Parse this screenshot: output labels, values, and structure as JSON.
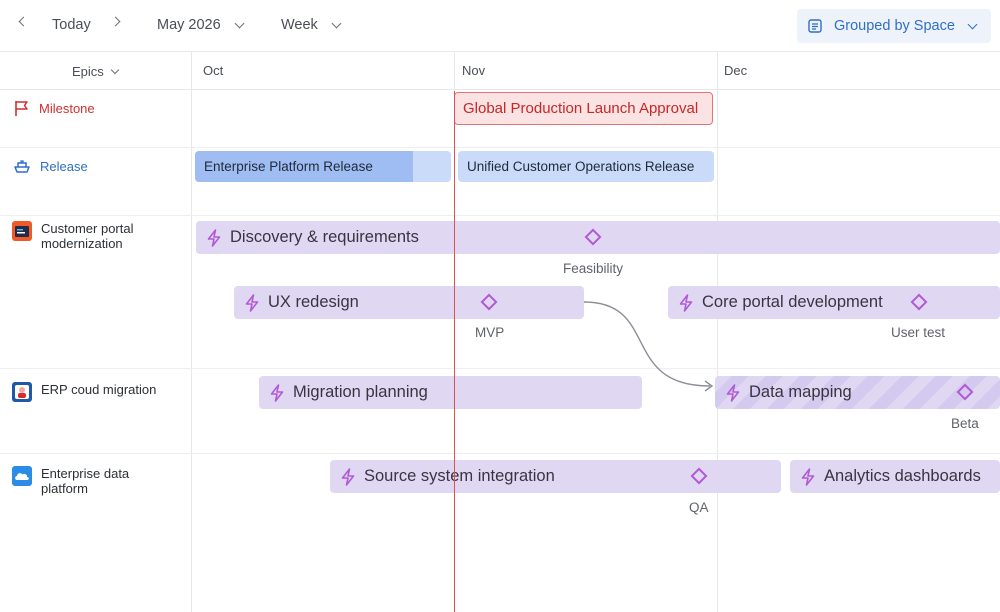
{
  "toolbar": {
    "today_label": "Today",
    "period_label": "May 2026",
    "scale_label": "Week",
    "grouping_label": "Grouped by Space"
  },
  "header": {
    "column_label": "Epics",
    "months": [
      "Oct",
      "Nov",
      "Dec"
    ]
  },
  "rows": {
    "milestone": {
      "label": "Milestone",
      "color": "#d32f2f"
    },
    "release": {
      "label": "Release",
      "color": "#2f6fc7"
    },
    "spaces": [
      {
        "label": "Customer portal modernization",
        "icon": "portal-app-icon"
      },
      {
        "label": "ERP coud migration",
        "icon": "erp-app-icon"
      },
      {
        "label": "Enterprise data platform",
        "icon": "cloud-app-icon"
      }
    ]
  },
  "bars": {
    "milestone": "Global Production Launch Approval",
    "releases": [
      {
        "label": "Enterprise Platform Release",
        "progress": 0.85
      },
      {
        "label": "Unified Customer Operations Release"
      }
    ],
    "epics": {
      "discovery": "Discovery & requirements",
      "ux": "UX redesign",
      "core": "Core portal development",
      "migration": "Migration planning",
      "mapping": "Data mapping",
      "source": "Source system integration",
      "analytics": "Analytics dashboards"
    },
    "milestones": {
      "feasibility": "Feasibility",
      "mvp": "MVP",
      "user_test": "User test",
      "beta": "Beta",
      "qa": "QA"
    }
  },
  "colors": {
    "accent": "#2f6fc7",
    "milestone": "#d32f2f",
    "epic_fill": "#e0d8f3",
    "epic_icon": "#b05ad6",
    "release_fill": "#c9dbf9",
    "release_progress": "#9fbdf2"
  }
}
